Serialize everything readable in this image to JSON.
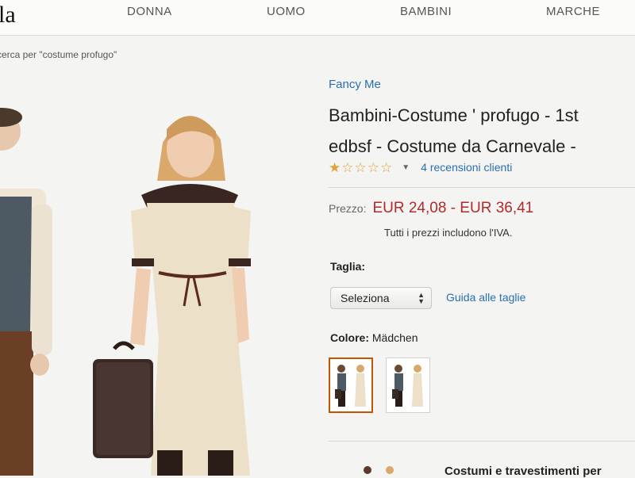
{
  "header": {
    "logo": "la",
    "nav": [
      "DONNA",
      "UOMO",
      "BAMBINI",
      "MARCHE"
    ]
  },
  "breadcrumb": "cerca per \"costume profugo\"",
  "product": {
    "brand": "Fancy Me",
    "title_line1": "Bambini-Costume ' profugo - 1st",
    "title_line2": "edbsf - Costume da Carnevale -",
    "rating": {
      "value": 1,
      "max": 5
    },
    "reviews": "4 recensioni clienti",
    "price_label": "Prezzo:",
    "price": "EUR 24,08 - EUR 36,41",
    "vat_note": "Tutti i prezzi includono l'IVA.",
    "size_label": "Taglia:",
    "size_value": "Seleziona",
    "size_guide": "Guida alle taglie",
    "color_label": "Colore:",
    "color_value": "Mädchen",
    "bottom_text": "Costumi e travestimenti per"
  },
  "colors": {
    "link": "#2a6fb0",
    "price": "#b12a2a",
    "star": "#e0a33a",
    "swatch_selected": "#c45500"
  },
  "icons": [
    "star-icon",
    "caret-down-icon",
    "select-arrows-icon"
  ]
}
